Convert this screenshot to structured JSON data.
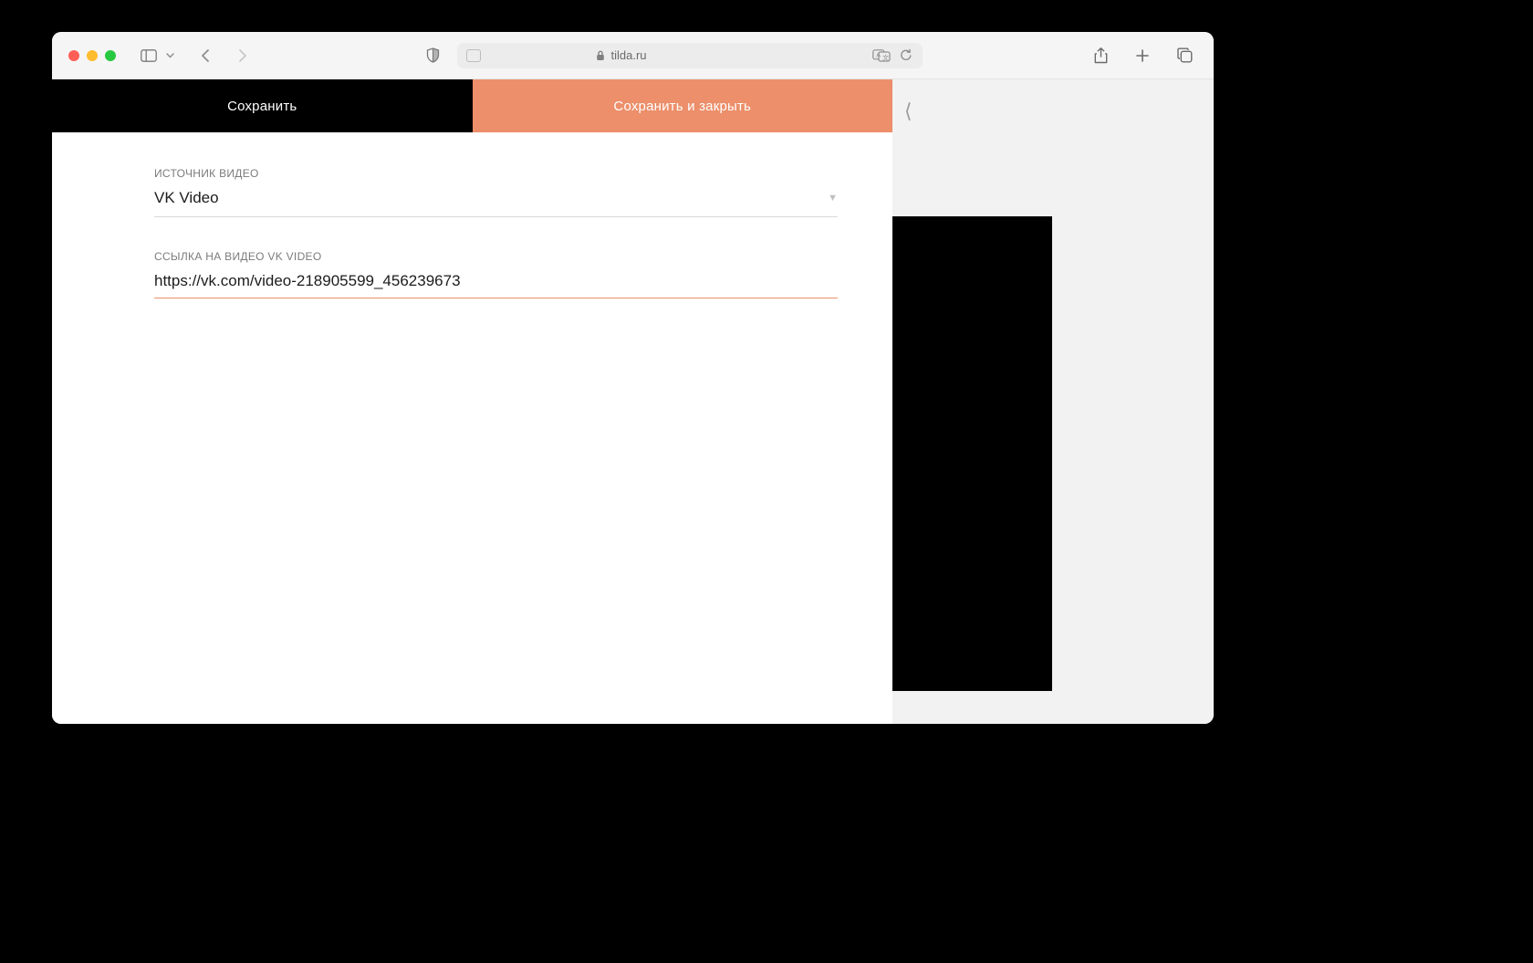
{
  "browser": {
    "host": "tilda.ru"
  },
  "tabs": {
    "save": "Сохранить",
    "save_close": "Сохранить и закрыть"
  },
  "fields": {
    "source": {
      "label": "ИСТОЧНИК ВИДЕО",
      "value": "VK Video"
    },
    "link": {
      "label": "ССЫЛКА НА ВИДЕО VK VIDEO",
      "value": "https://vk.com/video-218905599_456239673"
    }
  },
  "close_glyph": "⟨",
  "colors": {
    "accent": "#ec8f6a"
  }
}
